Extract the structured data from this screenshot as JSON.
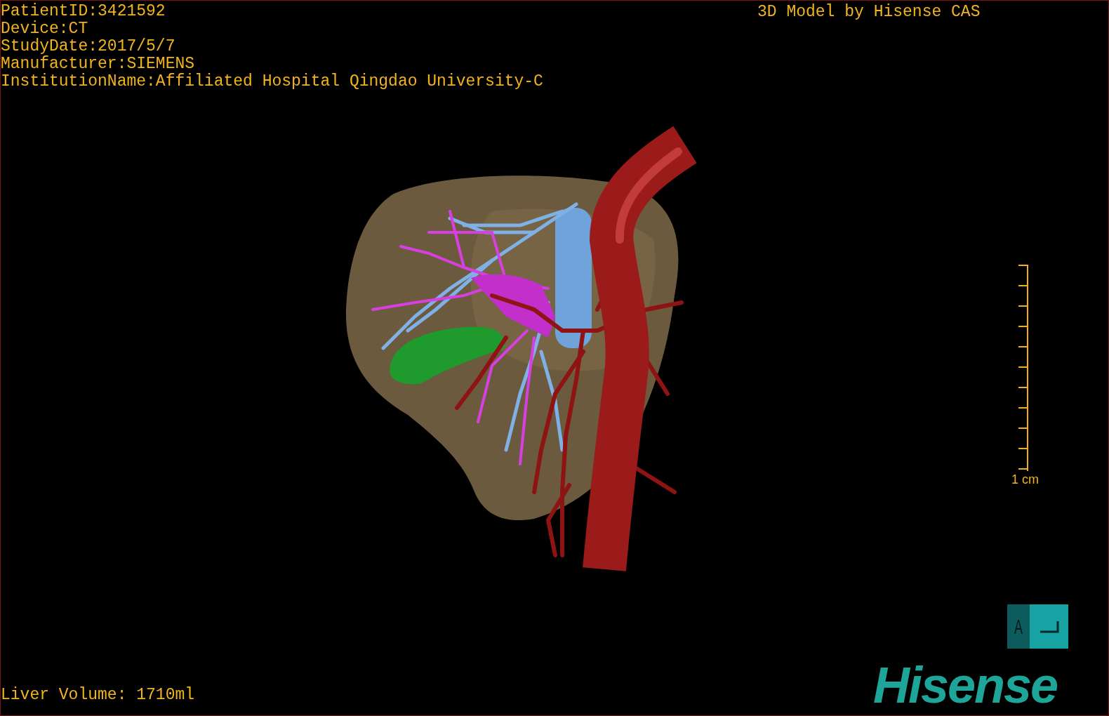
{
  "patient_info": [
    "PatientID:3421592",
    "Device:CT",
    "StudyDate:2017/5/7",
    "Manufacturer:SIEMENS",
    "InstitutionName:Affiliated Hospital Qingdao University-C"
  ],
  "model_title": "3D Model by Hisense CAS",
  "scale_bar": {
    "label": "1 cm"
  },
  "orientation_cube": {
    "face_label": "A"
  },
  "logo": "Hisense",
  "liver_volume": "Liver Volume: 1710ml"
}
